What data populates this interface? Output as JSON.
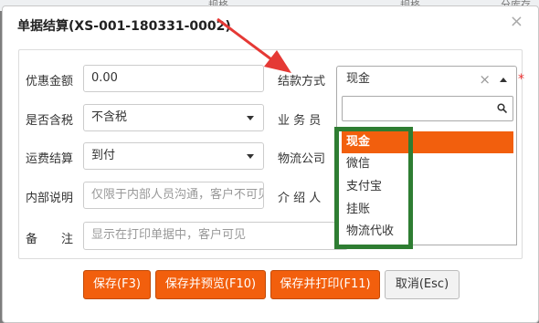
{
  "background": {
    "col1": "规格",
    "col2": "规格",
    "col3": "分库存"
  },
  "dialog": {
    "title": "单据结算(XS-001-180331-0002)",
    "close_label": "×"
  },
  "form": {
    "discount_label": "优惠金额",
    "discount_value": "0.00",
    "tax_label": "是否含税",
    "tax_value": "不含税",
    "freight_label": "运费结算",
    "freight_value": "到付",
    "note_label": "内部说明",
    "note_placeholder": "仅限于内部人员沟通，客户不可见",
    "remark_label": "备　　注",
    "remark_placeholder": "显示在打印单据中，客户可见",
    "payment_label": "结款方式",
    "payment_value": "现金",
    "payment_clear": "×",
    "required_mark": "*",
    "salesman_label": "业 务 员",
    "logistics_label": "物流公司",
    "referrer_label": "介 绍 人"
  },
  "payment_options": [
    "现金",
    "微信",
    "支付宝",
    "挂账",
    "物流代收"
  ],
  "buttons": {
    "save": "保存(F3)",
    "save_preview": "保存并预览(F10)",
    "save_print": "保存并打印(F11)",
    "cancel": "取消(Esc)"
  },
  "colors": {
    "accent": "#f25f0d",
    "highlight_box": "#2e7d32",
    "arrow": "#e53935"
  }
}
